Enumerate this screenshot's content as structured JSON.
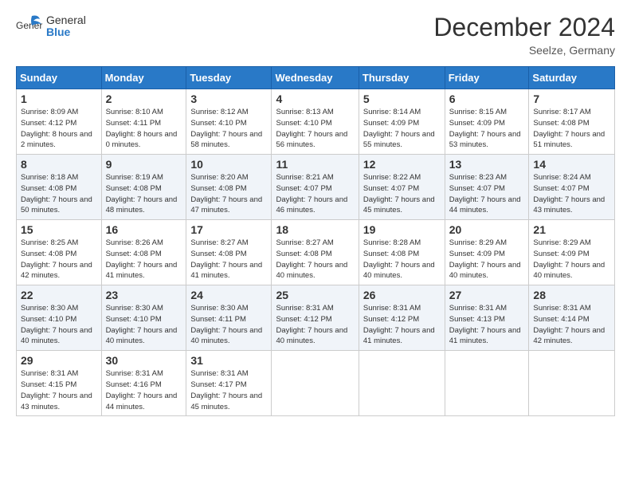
{
  "header": {
    "logo_general": "General",
    "logo_blue": "Blue",
    "month_title": "December 2024",
    "location": "Seelze, Germany"
  },
  "days_of_week": [
    "Sunday",
    "Monday",
    "Tuesday",
    "Wednesday",
    "Thursday",
    "Friday",
    "Saturday"
  ],
  "weeks": [
    [
      {
        "day": 1,
        "sunrise": "8:09 AM",
        "sunset": "4:12 PM",
        "daylight": "8 hours and 2 minutes."
      },
      {
        "day": 2,
        "sunrise": "8:10 AM",
        "sunset": "4:11 PM",
        "daylight": "8 hours and 0 minutes."
      },
      {
        "day": 3,
        "sunrise": "8:12 AM",
        "sunset": "4:10 PM",
        "daylight": "7 hours and 58 minutes."
      },
      {
        "day": 4,
        "sunrise": "8:13 AM",
        "sunset": "4:10 PM",
        "daylight": "7 hours and 56 minutes."
      },
      {
        "day": 5,
        "sunrise": "8:14 AM",
        "sunset": "4:09 PM",
        "daylight": "7 hours and 55 minutes."
      },
      {
        "day": 6,
        "sunrise": "8:15 AM",
        "sunset": "4:09 PM",
        "daylight": "7 hours and 53 minutes."
      },
      {
        "day": 7,
        "sunrise": "8:17 AM",
        "sunset": "4:08 PM",
        "daylight": "7 hours and 51 minutes."
      }
    ],
    [
      {
        "day": 8,
        "sunrise": "8:18 AM",
        "sunset": "4:08 PM",
        "daylight": "7 hours and 50 minutes."
      },
      {
        "day": 9,
        "sunrise": "8:19 AM",
        "sunset": "4:08 PM",
        "daylight": "7 hours and 48 minutes."
      },
      {
        "day": 10,
        "sunrise": "8:20 AM",
        "sunset": "4:08 PM",
        "daylight": "7 hours and 47 minutes."
      },
      {
        "day": 11,
        "sunrise": "8:21 AM",
        "sunset": "4:07 PM",
        "daylight": "7 hours and 46 minutes."
      },
      {
        "day": 12,
        "sunrise": "8:22 AM",
        "sunset": "4:07 PM",
        "daylight": "7 hours and 45 minutes."
      },
      {
        "day": 13,
        "sunrise": "8:23 AM",
        "sunset": "4:07 PM",
        "daylight": "7 hours and 44 minutes."
      },
      {
        "day": 14,
        "sunrise": "8:24 AM",
        "sunset": "4:07 PM",
        "daylight": "7 hours and 43 minutes."
      }
    ],
    [
      {
        "day": 15,
        "sunrise": "8:25 AM",
        "sunset": "4:08 PM",
        "daylight": "7 hours and 42 minutes."
      },
      {
        "day": 16,
        "sunrise": "8:26 AM",
        "sunset": "4:08 PM",
        "daylight": "7 hours and 41 minutes."
      },
      {
        "day": 17,
        "sunrise": "8:27 AM",
        "sunset": "4:08 PM",
        "daylight": "7 hours and 41 minutes."
      },
      {
        "day": 18,
        "sunrise": "8:27 AM",
        "sunset": "4:08 PM",
        "daylight": "7 hours and 40 minutes."
      },
      {
        "day": 19,
        "sunrise": "8:28 AM",
        "sunset": "4:08 PM",
        "daylight": "7 hours and 40 minutes."
      },
      {
        "day": 20,
        "sunrise": "8:29 AM",
        "sunset": "4:09 PM",
        "daylight": "7 hours and 40 minutes."
      },
      {
        "day": 21,
        "sunrise": "8:29 AM",
        "sunset": "4:09 PM",
        "daylight": "7 hours and 40 minutes."
      }
    ],
    [
      {
        "day": 22,
        "sunrise": "8:30 AM",
        "sunset": "4:10 PM",
        "daylight": "7 hours and 40 minutes."
      },
      {
        "day": 23,
        "sunrise": "8:30 AM",
        "sunset": "4:10 PM",
        "daylight": "7 hours and 40 minutes."
      },
      {
        "day": 24,
        "sunrise": "8:30 AM",
        "sunset": "4:11 PM",
        "daylight": "7 hours and 40 minutes."
      },
      {
        "day": 25,
        "sunrise": "8:31 AM",
        "sunset": "4:12 PM",
        "daylight": "7 hours and 40 minutes."
      },
      {
        "day": 26,
        "sunrise": "8:31 AM",
        "sunset": "4:12 PM",
        "daylight": "7 hours and 41 minutes."
      },
      {
        "day": 27,
        "sunrise": "8:31 AM",
        "sunset": "4:13 PM",
        "daylight": "7 hours and 41 minutes."
      },
      {
        "day": 28,
        "sunrise": "8:31 AM",
        "sunset": "4:14 PM",
        "daylight": "7 hours and 42 minutes."
      }
    ],
    [
      {
        "day": 29,
        "sunrise": "8:31 AM",
        "sunset": "4:15 PM",
        "daylight": "7 hours and 43 minutes."
      },
      {
        "day": 30,
        "sunrise": "8:31 AM",
        "sunset": "4:16 PM",
        "daylight": "7 hours and 44 minutes."
      },
      {
        "day": 31,
        "sunrise": "8:31 AM",
        "sunset": "4:17 PM",
        "daylight": "7 hours and 45 minutes."
      },
      null,
      null,
      null,
      null
    ]
  ]
}
